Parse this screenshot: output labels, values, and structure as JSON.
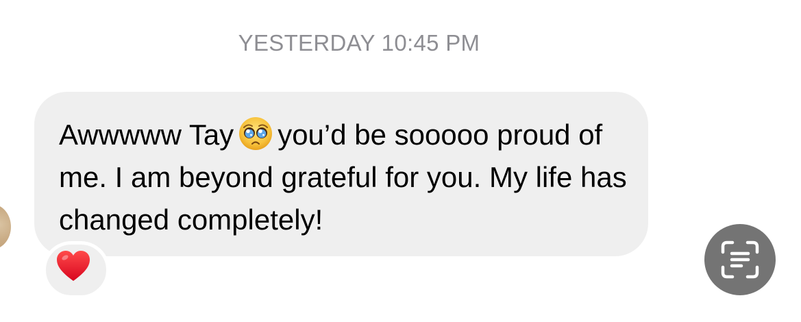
{
  "conversation": {
    "timestamp": "YESTERDAY 10:45 PM",
    "message": {
      "text_part1": "Awwwww Tay",
      "emoji": "pleading-face-emoji",
      "text_part2": "you’d be sooooo proud of me. I am beyond grateful for you. My life has changed completely!",
      "reaction": "heart-emoji"
    }
  },
  "overlay": {
    "live_text_icon": "text-scan-icon"
  },
  "colors": {
    "bubble": "#efefef",
    "timestamp": "#8e8e93",
    "heart": "#e8122a",
    "live_text_button": "#747474"
  }
}
